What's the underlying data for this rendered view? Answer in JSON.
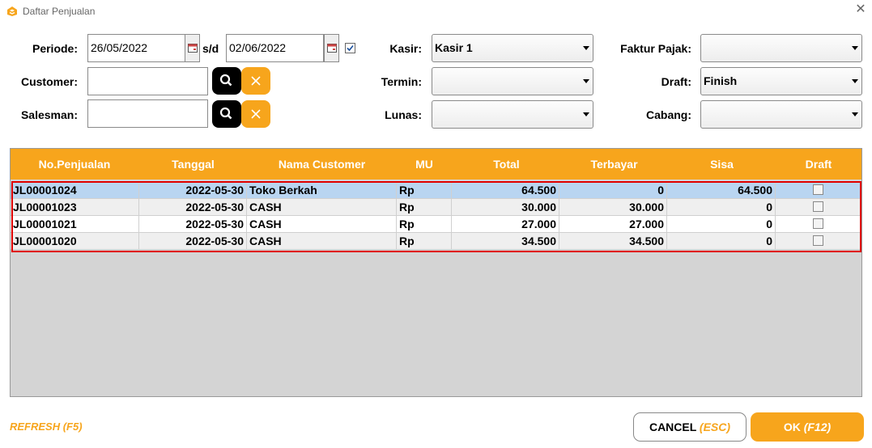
{
  "window": {
    "title": "Daftar Penjualan",
    "close_glyph": "✕",
    "icon": "app-logo-icon"
  },
  "filters": {
    "periode_label": "Periode:",
    "date_from": "26/05/2022",
    "sd_label": "s/d",
    "date_to": "02/06/2022",
    "date_range_checked": true,
    "customer_label": "Customer:",
    "customer_value": "",
    "salesman_label": "Salesman:",
    "salesman_value": "",
    "kasir_label": "Kasir:",
    "kasir_value": "Kasir 1",
    "termin_label": "Termin:",
    "termin_value": "",
    "lunas_label": "Lunas:",
    "lunas_value": "",
    "faktur_label": "Faktur Pajak:",
    "faktur_value": "",
    "draft_label": "Draft:",
    "draft_value": "Finish",
    "cabang_label": "Cabang:",
    "cabang_value": ""
  },
  "grid": {
    "headers": [
      "No.Penjualan",
      "Tanggal",
      "Nama Customer",
      "MU",
      "Total",
      "Terbayar",
      "Sisa",
      "Draft"
    ],
    "rows": [
      {
        "no": "JL00001024",
        "tanggal": "2022-05-30",
        "customer": "Toko Berkah",
        "mu": "Rp",
        "total": "64.500",
        "terbayar": "0",
        "sisa": "64.500",
        "draft": false,
        "selected": true
      },
      {
        "no": "JL00001023",
        "tanggal": "2022-05-30",
        "customer": "CASH",
        "mu": "Rp",
        "total": "30.000",
        "terbayar": "30.000",
        "sisa": "0",
        "draft": false,
        "selected": false
      },
      {
        "no": "JL00001021",
        "tanggal": "2022-05-30",
        "customer": "CASH",
        "mu": "Rp",
        "total": "27.000",
        "terbayar": "27.000",
        "sisa": "0",
        "draft": false,
        "selected": false
      },
      {
        "no": "JL00001020",
        "tanggal": "2022-05-30",
        "customer": "CASH",
        "mu": "Rp",
        "total": "34.500",
        "terbayar": "34.500",
        "sisa": "0",
        "draft": false,
        "selected": false
      }
    ]
  },
  "footer": {
    "refresh_label": "REFRESH (F5)",
    "cancel_label": "CANCEL",
    "cancel_key": "(ESC)",
    "ok_label": "OK",
    "ok_key": "(F12)"
  },
  "colors": {
    "accent": "#f7a51c",
    "selected_row": "#b9d5f1",
    "highlight_border": "#e00000"
  }
}
